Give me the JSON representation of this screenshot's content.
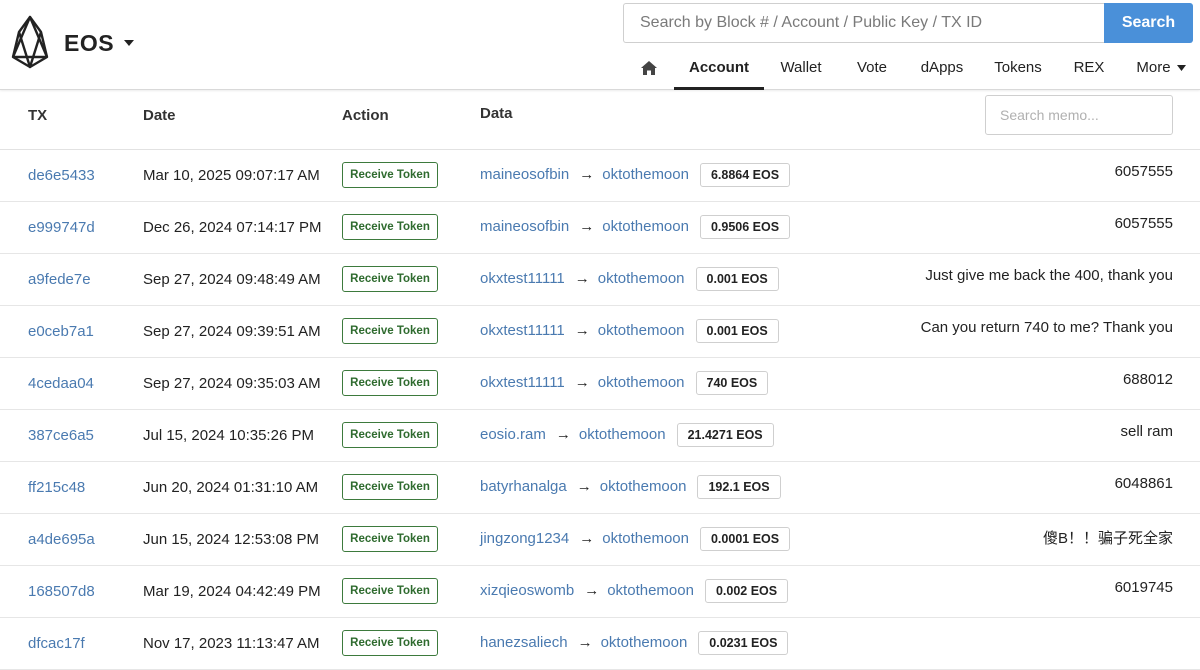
{
  "header": {
    "brand": "EOS",
    "search_placeholder": "Search by Block # / Account / Public Key / TX ID",
    "search_button": "Search",
    "nav": {
      "account": "Account",
      "wallet": "Wallet",
      "vote": "Vote",
      "dapps": "dApps",
      "tokens": "Tokens",
      "rex": "REX",
      "more": "More"
    }
  },
  "table": {
    "headers": {
      "tx": "TX",
      "date": "Date",
      "action": "Action",
      "data": "Data"
    },
    "memo_search_placeholder": "Search memo...",
    "rows": [
      {
        "tx": "de6e5433",
        "date": "Mar 10, 2025 09:07:17 AM",
        "action": "Receive Token",
        "from": "maineosofbin",
        "arrow": "→",
        "to": "oktothemoon",
        "quantity": "6.8864 EOS",
        "memo": "6057555"
      },
      {
        "tx": "e999747d",
        "date": "Dec 26, 2024 07:14:17 PM",
        "action": "Receive Token",
        "from": "maineosofbin",
        "arrow": "→",
        "to": "oktothemoon",
        "quantity": "0.9506 EOS",
        "memo": "6057555"
      },
      {
        "tx": "a9fede7e",
        "date": "Sep 27, 2024 09:48:49 AM",
        "action": "Receive Token",
        "from": "okxtest11111",
        "arrow": "→",
        "to": "oktothemoon",
        "quantity": "0.001 EOS",
        "memo": "Just give me back the 400, thank you"
      },
      {
        "tx": "e0ceb7a1",
        "date": "Sep 27, 2024 09:39:51 AM",
        "action": "Receive Token",
        "from": "okxtest11111",
        "arrow": "→",
        "to": "oktothemoon",
        "quantity": "0.001 EOS",
        "memo": "Can you return 740 to me? Thank you"
      },
      {
        "tx": "4cedaa04",
        "date": "Sep 27, 2024 09:35:03 AM",
        "action": "Receive Token",
        "from": "okxtest11111",
        "arrow": "→",
        "to": "oktothemoon",
        "quantity": "740 EOS",
        "memo": "688012"
      },
      {
        "tx": "387ce6a5",
        "date": "Jul 15, 2024 10:35:26 PM",
        "action": "Receive Token",
        "from": "eosio.ram",
        "arrow": "→",
        "to": "oktothemoon",
        "quantity": "21.4271 EOS",
        "memo": "sell ram"
      },
      {
        "tx": "ff215c48",
        "date": "Jun 20, 2024 01:31:10 AM",
        "action": "Receive Token",
        "from": "batyrhanalga",
        "arrow": "→",
        "to": "oktothemoon",
        "quantity": "192.1 EOS",
        "memo": "6048861"
      },
      {
        "tx": "a4de695a",
        "date": "Jun 15, 2024 12:53:08 PM",
        "action": "Receive Token",
        "from": "jingzong1234",
        "arrow": "→",
        "to": "oktothemoon",
        "quantity": "0.0001 EOS",
        "memo": "傻B！！骗子死全家"
      },
      {
        "tx": "168507d8",
        "date": "Mar 19, 2024 04:42:49 PM",
        "action": "Receive Token",
        "from": "xizqieoswomb",
        "arrow": "→",
        "to": "oktothemoon",
        "quantity": "0.002 EOS",
        "memo": "6019745"
      },
      {
        "tx": "dfcac17f",
        "date": "Nov 17, 2023 11:13:47 AM",
        "action": "Receive Token",
        "from": "hanezsaliech",
        "arrow": "→",
        "to": "oktothemoon",
        "quantity": "0.0231 EOS",
        "memo": ""
      }
    ]
  }
}
